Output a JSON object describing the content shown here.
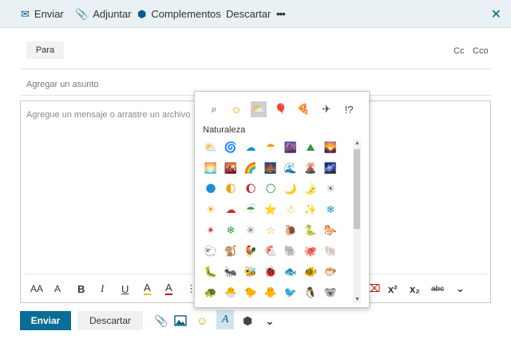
{
  "toolbar": {
    "send_label": "Enviar",
    "attach_label": "Adjuntar",
    "addins_label": "Complementos",
    "discard_label": "Descartar",
    "more_label": "•••",
    "close_label": "✕"
  },
  "header": {
    "to_label": "Para",
    "cc_label": "Cc",
    "bcc_label": "Cco",
    "subject_placeholder": "Agregar un asunto"
  },
  "body": {
    "placeholder": "Agregue un mensaje o arrastre un archivo"
  },
  "format": {
    "font_size_up": "AA",
    "font_size_down": "A",
    "bold": "B",
    "italic": "I",
    "underline": "U",
    "highlight": "A",
    "font_color": "A",
    "bullets": "⋮≡",
    "clear": "⌫",
    "superscript": "x²",
    "subscript": "x₂",
    "strikethrough": "abc",
    "more": "⌄"
  },
  "bottom": {
    "send_label": "Enviar",
    "discard_label": "Descartar",
    "expand": "⌄"
  },
  "emoji_picker": {
    "categories": [
      {
        "icon": "⌕"
      },
      {
        "icon": "☺"
      },
      {
        "icon": "⛅"
      },
      {
        "icon": "🎈"
      },
      {
        "icon": "🍕"
      },
      {
        "icon": "✈"
      },
      {
        "icon": "!?"
      }
    ],
    "section_title": "Naturaleza",
    "items": [
      [
        "⛅",
        "🌀",
        "☁",
        "☂",
        "🌆",
        "⛰",
        "🌄"
      ],
      [
        "🌅",
        "🌇",
        "🌈",
        "🌉",
        "🌊",
        "🌋",
        "🌌"
      ],
      [
        "🌑",
        "🌓",
        "🌔",
        "🌕",
        "🌙",
        "🌛",
        "☀"
      ],
      [
        "☀",
        "☁",
        "☔",
        "⭐",
        "☃",
        "✨",
        "❄"
      ],
      [
        "✴",
        "❄",
        "✳",
        "☆",
        "🐌",
        "🐍",
        "🐎"
      ],
      [
        "🐑",
        "🐒",
        "🐓",
        "🐔",
        "🐘",
        "🐙",
        "🐚"
      ],
      [
        "🐛",
        "🐜",
        "🐝",
        "🐞",
        "🐟",
        "🐠",
        "🐡"
      ],
      [
        "🐢",
        "🐣",
        "🐤",
        "🐥",
        "🐦",
        "🐧",
        "🐨"
      ]
    ]
  },
  "colors": {
    "accent": "#0a6d95",
    "topbar_bg": "#eaf1f5"
  }
}
